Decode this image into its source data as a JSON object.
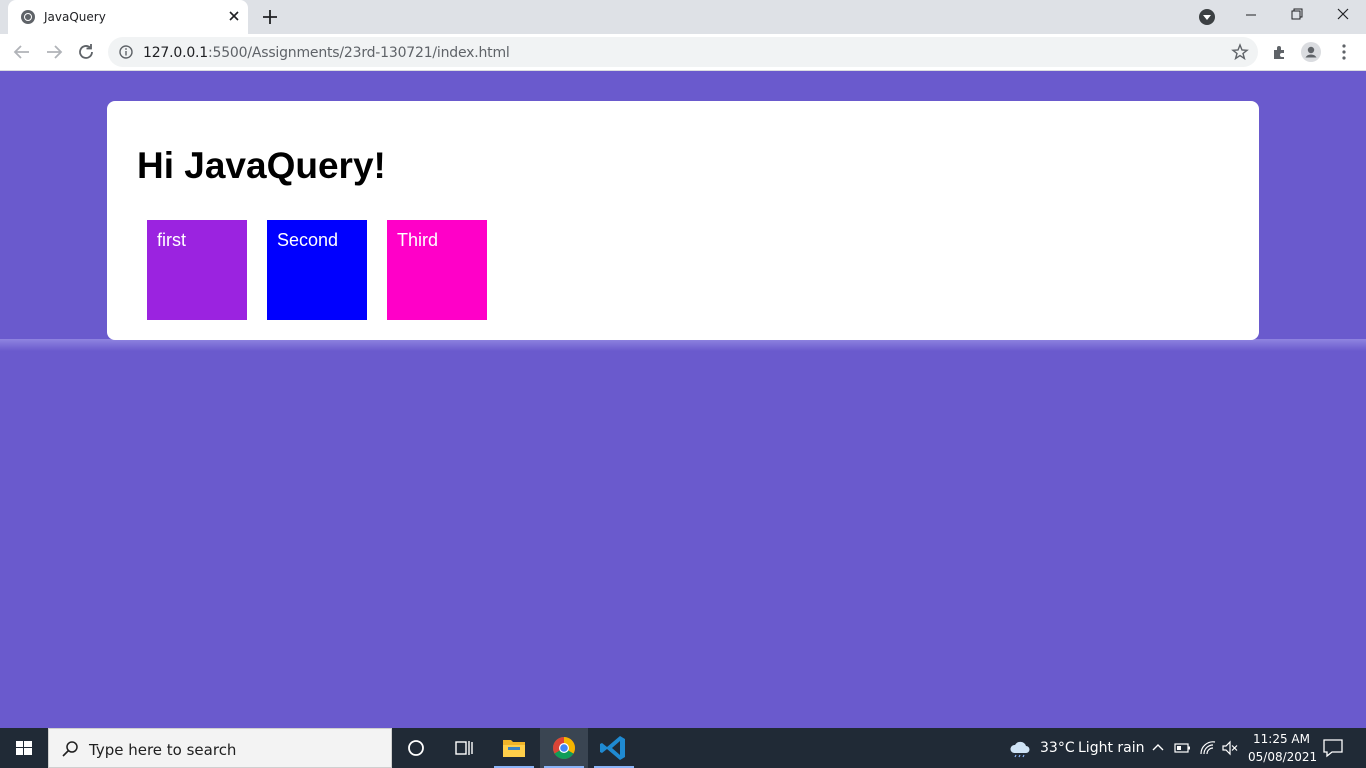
{
  "browser": {
    "tab_title": "JavaQuery",
    "url_host": "127.0.0.1",
    "url_rest": ":5500/Assignments/23rd-130721/index.html"
  },
  "page": {
    "heading": "Hi JavaQuery!",
    "boxes": [
      {
        "label": "first",
        "color": "#9b23e0"
      },
      {
        "label": "Second",
        "color": "#0000ff"
      },
      {
        "label": "Third",
        "color": "#ff00c8"
      }
    ],
    "background_color": "#6a5acd"
  },
  "taskbar": {
    "search_placeholder": "Type here to search",
    "weather_temp": "33°C",
    "weather_desc": "Light rain",
    "time": "11:25 AM",
    "date": "05/08/2021"
  }
}
